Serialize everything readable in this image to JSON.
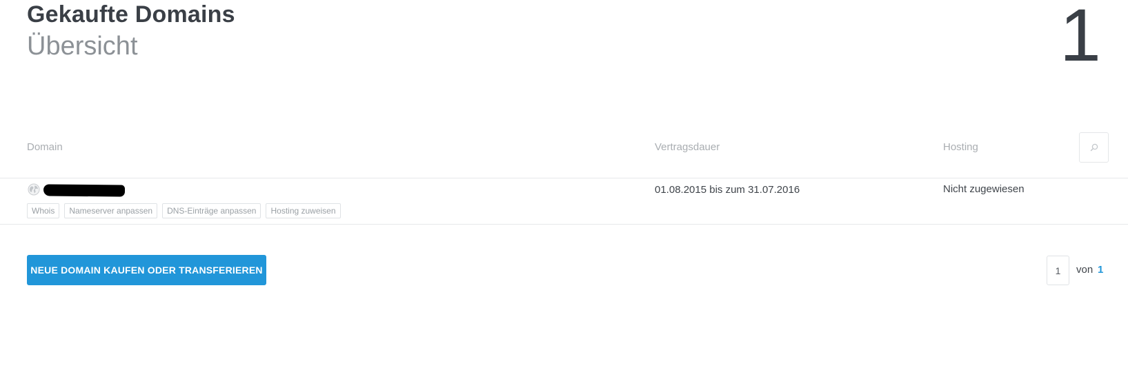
{
  "header": {
    "title": "Gekaufte Domains",
    "subtitle": "Übersicht",
    "count": "1"
  },
  "table": {
    "columns": {
      "domain": "Domain",
      "duration": "Vertragsdauer",
      "hosting": "Hosting"
    },
    "rows": [
      {
        "duration": "01.08.2015 bis zum 31.07.2016",
        "hosting": "Nicht zugewiesen",
        "actions": [
          "Whois",
          "Nameserver anpassen",
          "DNS-Einträge anpassen",
          "Hosting zuweisen"
        ]
      }
    ]
  },
  "actions": {
    "buy_label": "NEUE DOMAIN KAUFEN ODER TRANSFERIEREN"
  },
  "pagination": {
    "current": "1",
    "of_label": "von",
    "total": "1"
  },
  "icons": {
    "search": "search-icon",
    "globe": "globe-icon"
  },
  "colors": {
    "accent": "#2196d9",
    "title": "#3a3f46",
    "muted": "#a9adb1"
  }
}
